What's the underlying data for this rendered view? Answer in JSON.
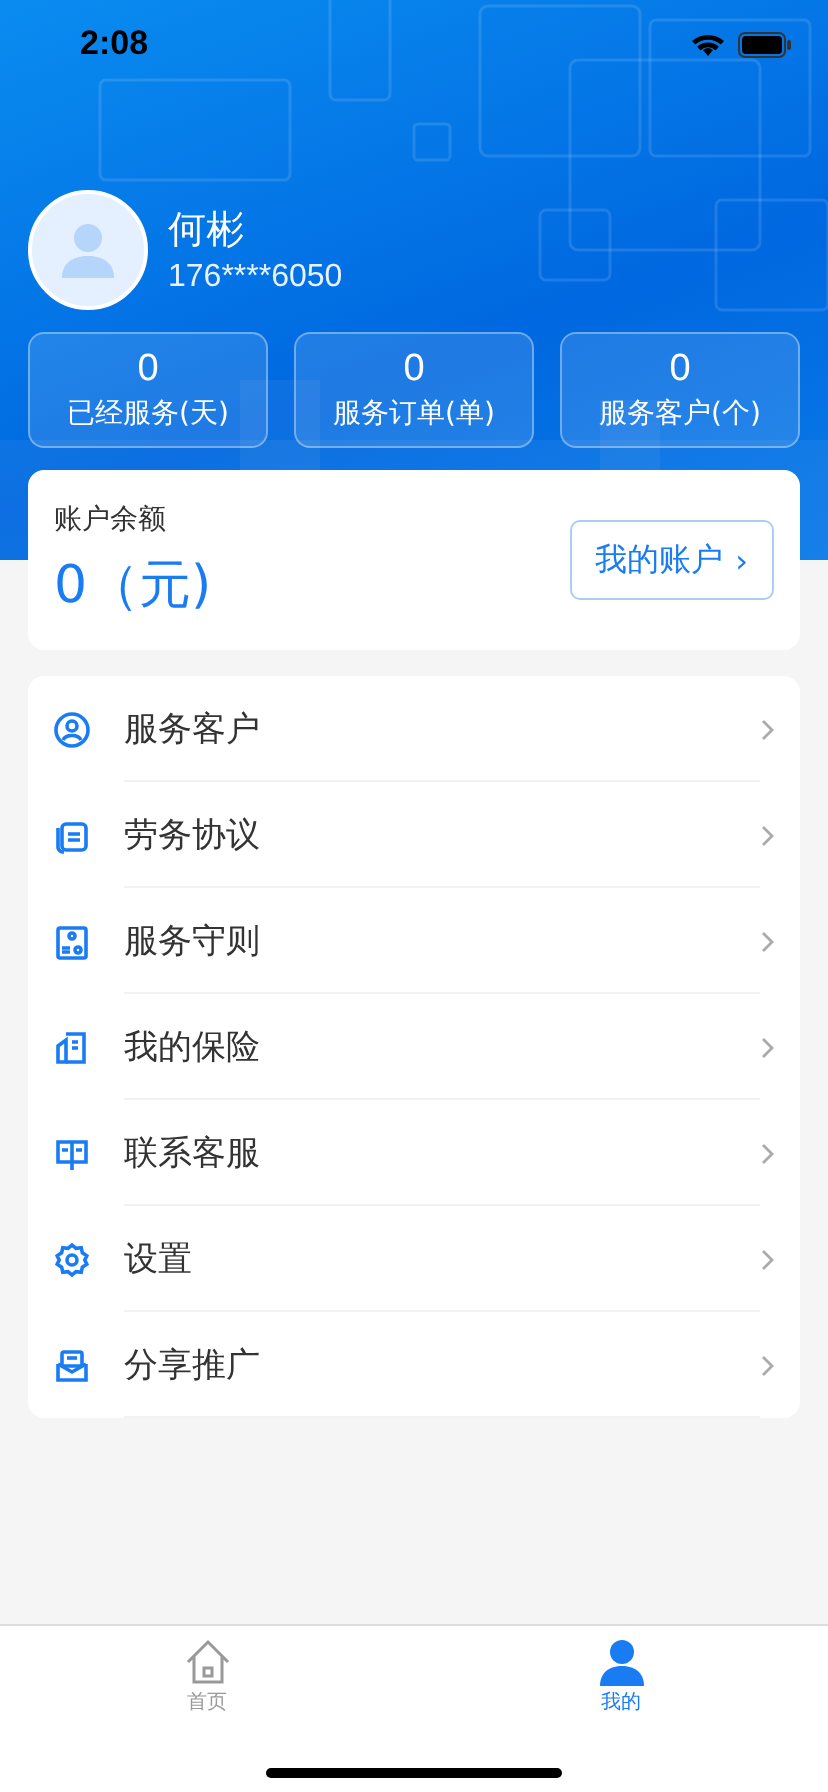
{
  "status_bar": {
    "time": "2:08"
  },
  "profile": {
    "name": "何彬",
    "phone": "176****6050"
  },
  "stats": [
    {
      "value": "0",
      "label": "已经服务(天)"
    },
    {
      "value": "0",
      "label": "服务订单(单)"
    },
    {
      "value": "0",
      "label": "服务客户(个)"
    }
  ],
  "balance": {
    "label": "账户余额",
    "amount": "0（元)",
    "button": "我的账户",
    "button_arrow": "›"
  },
  "menu": [
    {
      "kind": "customer",
      "label": "服务客户"
    },
    {
      "kind": "agreement",
      "label": "劳务协议"
    },
    {
      "kind": "rules",
      "label": "服务守则"
    },
    {
      "kind": "insurance",
      "label": "我的保险"
    },
    {
      "kind": "support",
      "label": "联系客服"
    },
    {
      "kind": "settings",
      "label": "设置"
    },
    {
      "kind": "share",
      "label": "分享推广"
    }
  ],
  "tabs": [
    {
      "kind": "home",
      "label": "首页",
      "selected": false
    },
    {
      "kind": "me",
      "label": "我的",
      "selected": true
    }
  ]
}
